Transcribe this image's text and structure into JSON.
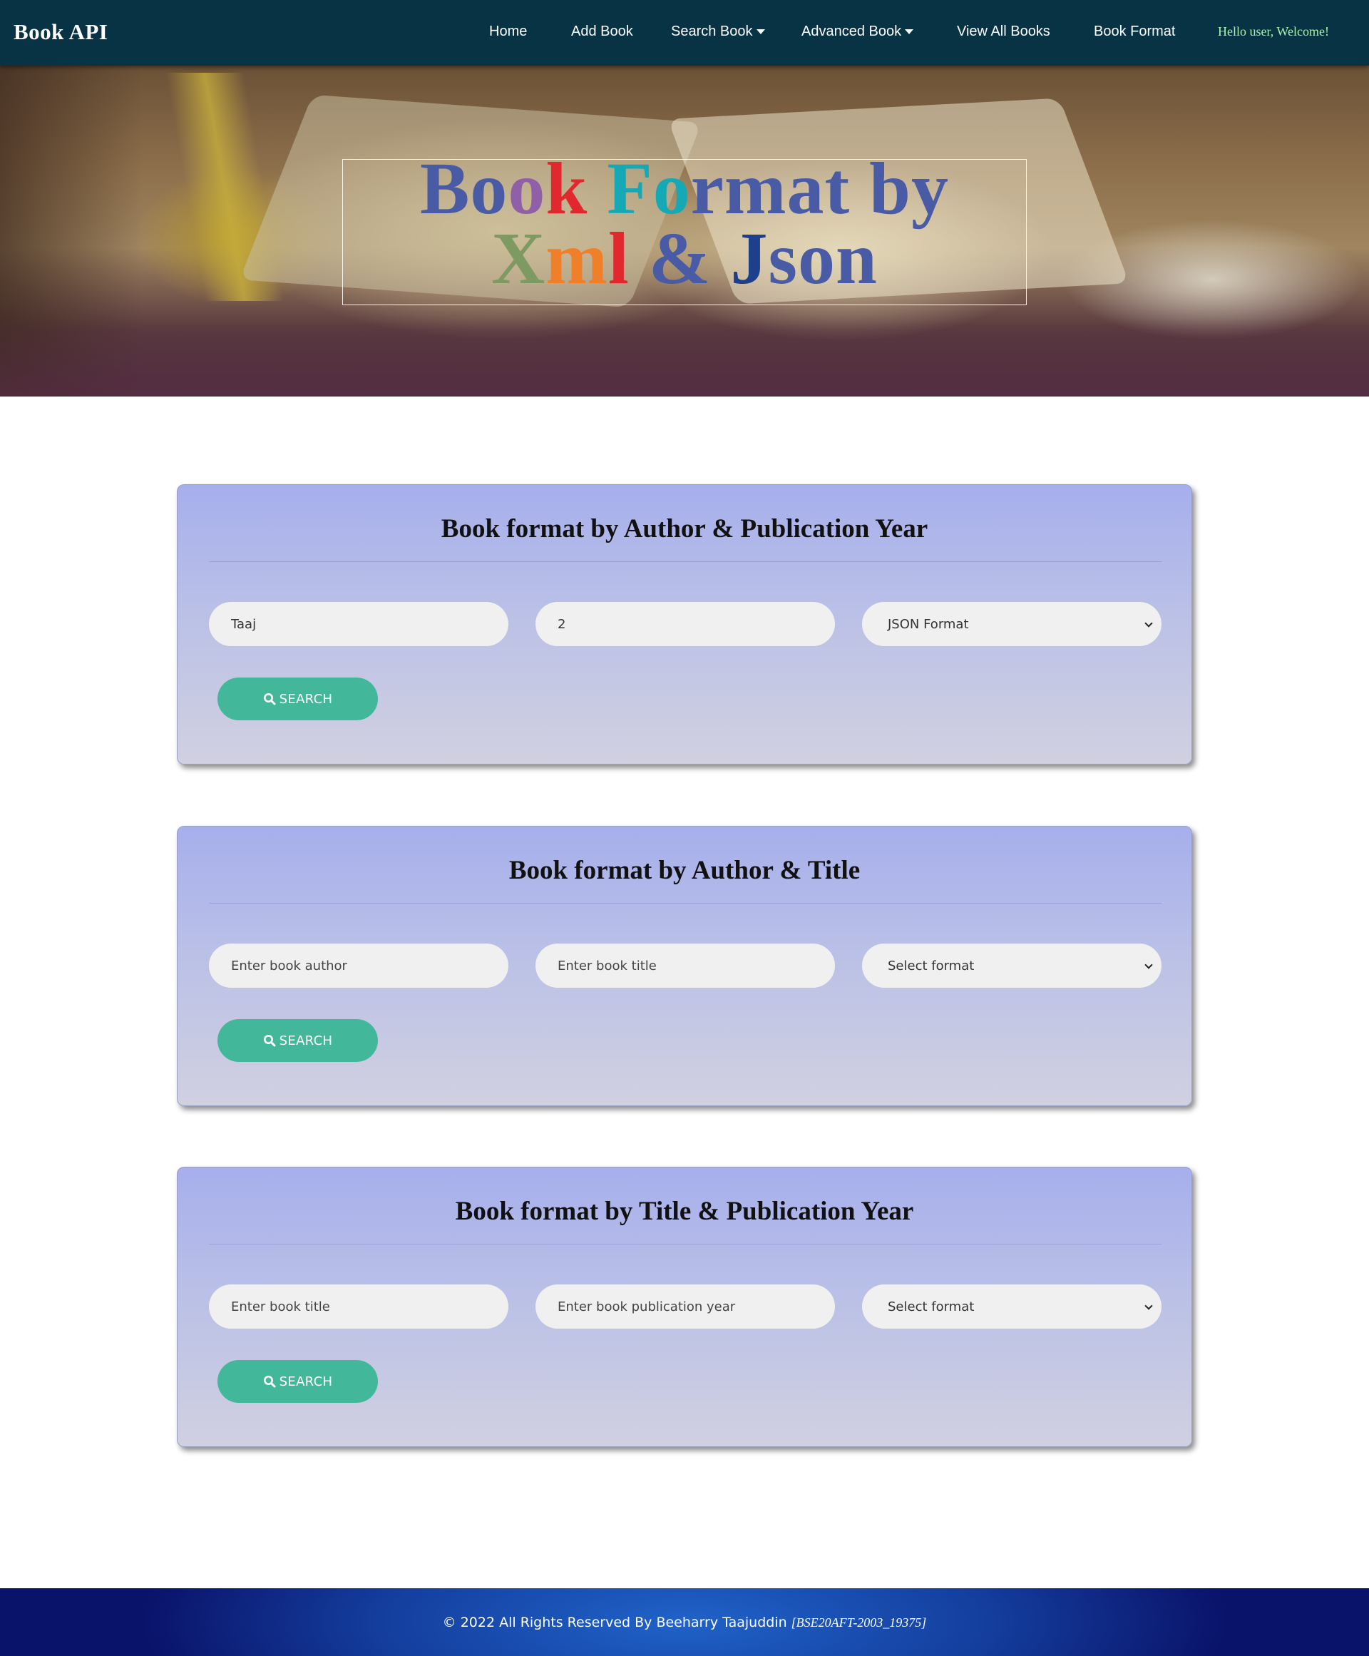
{
  "navbar": {
    "brand": "Book API",
    "items": [
      {
        "label": "Home"
      },
      {
        "label": "Add Book"
      },
      {
        "label": "Search Book"
      },
      {
        "label": "Advanced Book"
      },
      {
        "label": "View All Books"
      },
      {
        "label": "Book Format"
      }
    ],
    "welcome": "Hello user, Welcome!"
  },
  "hero": {
    "title_line1": "Book Format by",
    "title_line2": "Xml & Json",
    "title_colors": [
      "#4a5ba6",
      "#8f5fa8",
      "#e0282e",
      "#15a8b5",
      "#f07f2a",
      "#7e9a63",
      "#1d3f8c"
    ]
  },
  "cards": [
    {
      "title": "Book format by Author & Publication Year",
      "field1": {
        "value": "Taaj",
        "placeholder": "Enter book author"
      },
      "field2": {
        "value": "2",
        "placeholder": "Enter book publication year"
      },
      "format": {
        "value": "JSON Format"
      },
      "button": "SEARCH"
    },
    {
      "title": "Book format by Author & Title",
      "field1": {
        "value": "",
        "placeholder": "Enter book author"
      },
      "field2": {
        "value": "",
        "placeholder": "Enter book title"
      },
      "format": {
        "value": "Select format"
      },
      "button": "SEARCH"
    },
    {
      "title": "Book format by Title & Publication Year",
      "field1": {
        "value": "",
        "placeholder": "Enter book title"
      },
      "field2": {
        "value": "",
        "placeholder": "Enter book publication year"
      },
      "format": {
        "value": "Select format"
      },
      "button": "SEARCH"
    }
  ],
  "footer": {
    "text": "© 2022 All Rights Reserved By Beeharry Taajuddin",
    "student_id": "[BSE20AFT-2003_19375]"
  },
  "colors": {
    "navbar": "#083344",
    "button": "#43b79a",
    "welcome": "#a6f3a6"
  }
}
